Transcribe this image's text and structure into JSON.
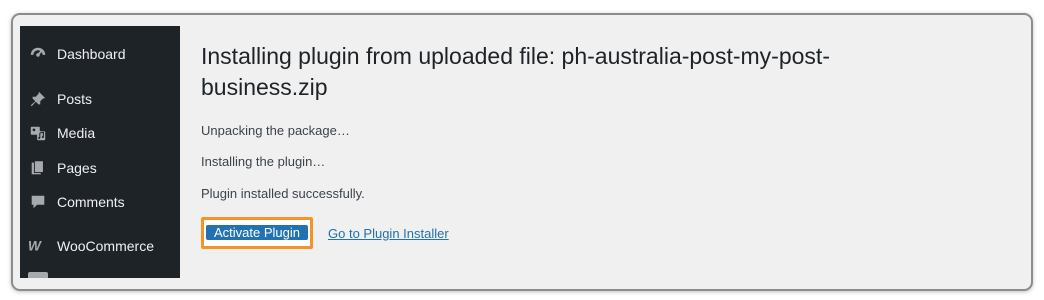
{
  "sidebar": {
    "items": [
      {
        "label": "Dashboard",
        "icon": "dashboard-icon"
      },
      {
        "label": "Posts",
        "icon": "pin-icon"
      },
      {
        "label": "Media",
        "icon": "media-icon"
      },
      {
        "label": "Pages",
        "icon": "pages-icon"
      },
      {
        "label": "Comments",
        "icon": "comment-icon"
      },
      {
        "label": "WooCommerce",
        "icon": "woocommerce-icon"
      }
    ]
  },
  "main": {
    "heading": "Installing plugin from uploaded file: ph-australia-post-my-post-business.zip",
    "messages": [
      "Unpacking the package…",
      "Installing the plugin…",
      "Plugin installed successfully."
    ],
    "activate_label": "Activate Plugin",
    "installer_link_label": "Go to Plugin Installer"
  },
  "colors": {
    "sidebar_bg": "#1d2327",
    "content_bg": "#f0f0f1",
    "primary_button": "#2271b1",
    "highlight_border": "#f39527",
    "link": "#2271b1"
  }
}
